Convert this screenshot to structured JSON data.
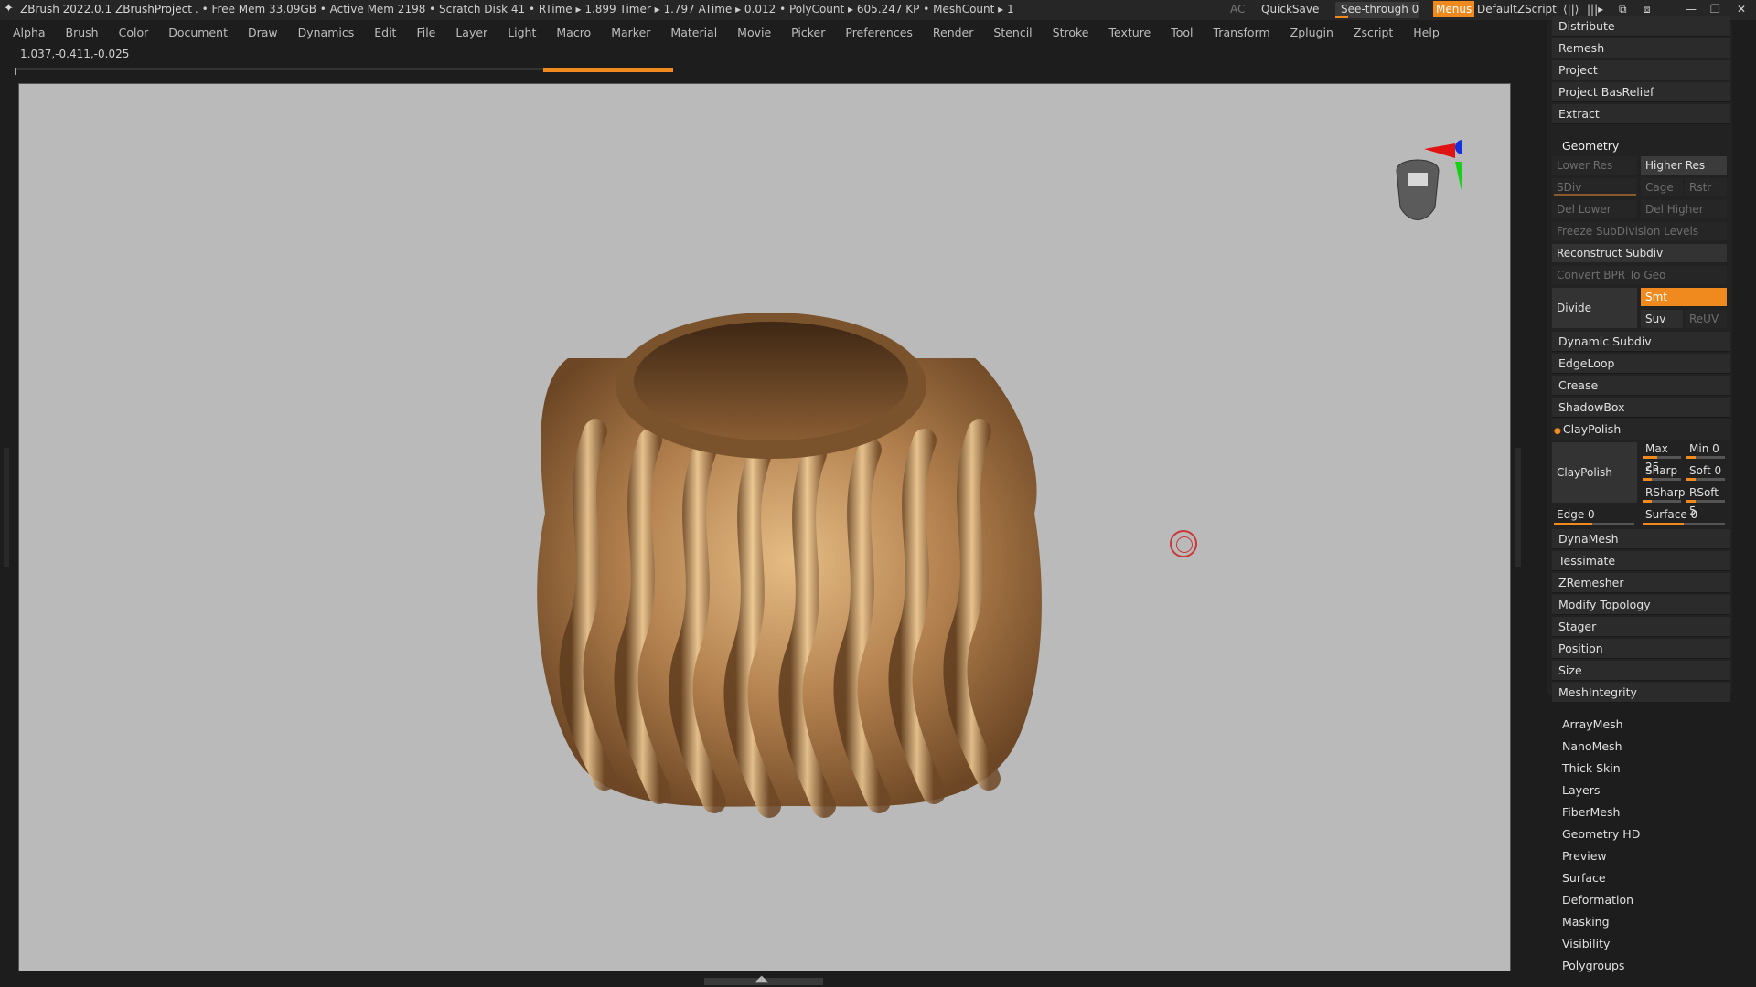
{
  "titlebar": {
    "app": "ZBrush 2022.0.1",
    "project": "ZBrushProject",
    "stats": ". • Free Mem 33.09GB • Active Mem 2198 • Scratch Disk 41 •  RTime ▸ 1.899 Timer ▸ 1.797 ATime ▸ 0.012 • PolyCount ▸ 605.247 KP  • MeshCount ▸ 1",
    "ac": "AC",
    "quicksave": "QuickSave",
    "seethrough": "See-through  0",
    "seethrough_value": 0,
    "menus": "Menus",
    "script": "DefaultZScript"
  },
  "menu": [
    "Alpha",
    "Brush",
    "Color",
    "Document",
    "Draw",
    "Dynamics",
    "Edit",
    "File",
    "Layer",
    "Light",
    "Macro",
    "Marker",
    "Material",
    "Movie",
    "Picker",
    "Preferences",
    "Render",
    "Stencil",
    "Stroke",
    "Texture",
    "Tool",
    "Transform",
    "Zplugin",
    "Zscript",
    "Help"
  ],
  "coords": "1.037,-0.411,-0.025",
  "panel": {
    "top_buttons": [
      "Distribute",
      "Remesh",
      "Project",
      "Project BasRelief",
      "Extract"
    ],
    "geometry": {
      "header": "Geometry",
      "lower_res": "Lower Res",
      "higher_res": "Higher Res",
      "sdiv": "SDiv",
      "cage": "Cage",
      "rstr": "Rstr",
      "del_lower": "Del Lower",
      "del_higher": "Del Higher",
      "freeze": "Freeze SubDivision Levels",
      "reconstruct": "Reconstruct Subdiv",
      "convert_bpr": "Convert BPR To Geo",
      "divide": "Divide",
      "smt": "Smt",
      "suv": "Suv",
      "reuv": "ReUV",
      "items_a": [
        "Dynamic Subdiv",
        "EdgeLoop",
        "Crease",
        "ShadowBox"
      ],
      "claypolish_header": "ClayPolish",
      "claypolish_btn": "ClayPolish",
      "max": "Max 25",
      "min": "Min 0",
      "sharp": "Sharp",
      "soft": "Soft 0",
      "rsharp": "RSharp",
      "rsoft": "RSoft 5",
      "edge": "Edge 0",
      "surface": "Surface 0",
      "items_b": [
        "DynaMesh",
        "Tessimate",
        "ZRemesher",
        "Modify Topology",
        "Stager",
        "Position",
        "Size",
        "MeshIntegrity"
      ]
    },
    "subpalettes": [
      "ArrayMesh",
      "NanoMesh",
      "Thick Skin",
      "Layers",
      "FiberMesh",
      "Geometry HD",
      "Preview",
      "Surface",
      "Deformation",
      "Masking",
      "Visibility",
      "Polygroups"
    ]
  },
  "colors": {
    "accent": "#f08a1e",
    "viewport": "#bababa",
    "panel": "#2b2b2b",
    "model": "#b88a55"
  }
}
